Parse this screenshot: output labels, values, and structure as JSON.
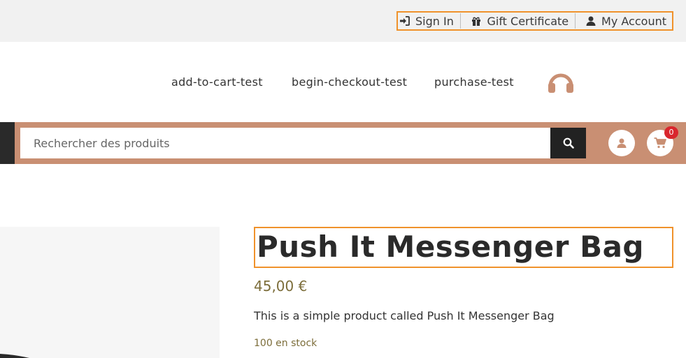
{
  "topbar": {
    "links": [
      {
        "label": "Sign In",
        "icon": "sign-in-icon"
      },
      {
        "label": "Gift Certificate",
        "icon": "gift-icon"
      },
      {
        "label": "My Account",
        "icon": "user-icon"
      }
    ]
  },
  "nav": {
    "items": [
      "add-to-cart-test",
      "begin-checkout-test",
      "purchase-test"
    ],
    "logo_icon": "headphones-icon"
  },
  "search": {
    "placeholder": "Rechercher des produits",
    "button_icon": "search-icon"
  },
  "header_actions": {
    "account_icon": "user-icon",
    "cart_icon": "cart-icon",
    "cart_count": "0"
  },
  "product": {
    "title": "Push It Messenger Bag",
    "price": "45,00 €",
    "description": "This is a simple product called Push It Messenger Bag",
    "stock": "100 en stock"
  },
  "colors": {
    "accent_border": "#f0922b",
    "search_bar": "#c98f73",
    "badge": "#d9262d",
    "price": "#7c6d3a"
  }
}
